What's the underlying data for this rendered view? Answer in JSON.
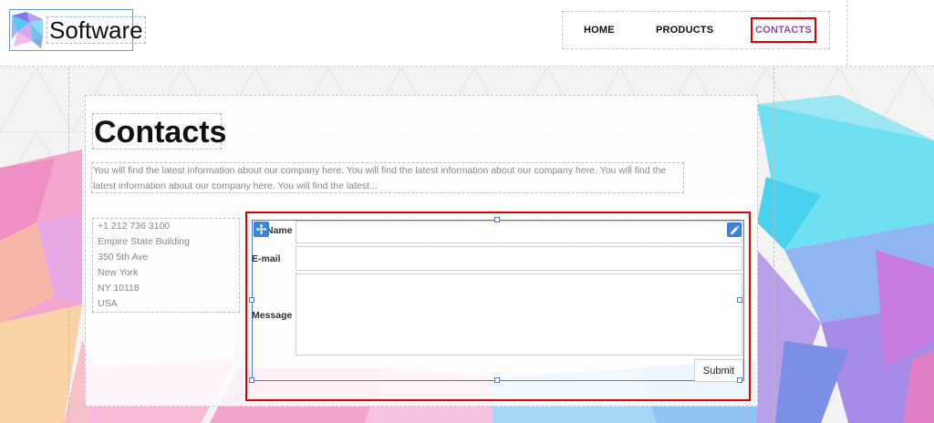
{
  "header": {
    "logo_text": "Software",
    "nav": {
      "home": "HOME",
      "products": "PRODUCTS",
      "contacts": "CONTACTS"
    }
  },
  "page": {
    "title": "Contacts",
    "intro": "You will find the latest information about our company here. You will find the latest information about our company here. You will find the latest information about our company here. You will find the latest..."
  },
  "address": {
    "phone": "+1 212 736 3100",
    "line1": "Empire State Building",
    "line2": "350 5th Ave",
    "line3": "New York",
    "line4": "NY 10118",
    "line5": "USA"
  },
  "form": {
    "name_label": "Name",
    "email_label": "E-mail",
    "message_label": "Message",
    "submit_label": "Submit"
  },
  "icons": {
    "move": "move-icon",
    "edit": "pencil-icon"
  },
  "colors": {
    "active_nav": "#9b3fb8",
    "highlight_border": "#e00000",
    "selection_blue": "#4a7fd8"
  }
}
